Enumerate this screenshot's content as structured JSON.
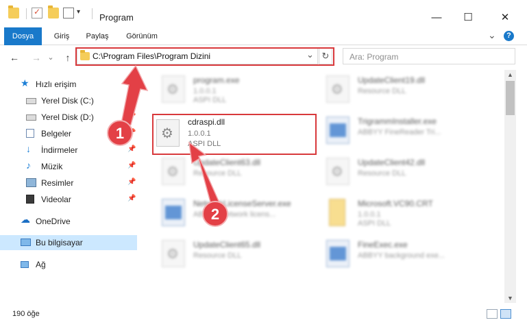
{
  "window": {
    "title": "Program",
    "min_glyph": "—",
    "max_glyph": "☐",
    "close_glyph": "✕"
  },
  "ribbon": {
    "tabs": [
      "Dosya",
      "Giriş",
      "Paylaş",
      "Görünüm"
    ],
    "expand_glyph": "⌄",
    "help_glyph": "?"
  },
  "nav": {
    "back_glyph": "←",
    "forward_glyph": "→",
    "recent_glyph": "⌄",
    "up_glyph": "↑",
    "address": "C:\\Program Files\\Program Dizini",
    "address_dropdown_glyph": "⌄",
    "refresh_glyph": "↻",
    "search_placeholder": "Ara: Program"
  },
  "sidebar": {
    "quick_access": "Hızlı erişim",
    "items": [
      {
        "label": "Yerel Disk (C:)",
        "icon": "drive-icon",
        "pinned": true
      },
      {
        "label": "Yerel Disk (D:)",
        "icon": "drive-icon",
        "pinned": true
      },
      {
        "label": "Belgeler",
        "icon": "documents-icon",
        "pinned": true
      },
      {
        "label": "İndirmeler",
        "icon": "downloads-icon",
        "pinned": true
      },
      {
        "label": "Müzik",
        "icon": "music-icon",
        "pinned": true
      },
      {
        "label": "Resimler",
        "icon": "pictures-icon",
        "pinned": true
      },
      {
        "label": "Videolar",
        "icon": "videos-icon",
        "pinned": true
      }
    ],
    "onedrive": "OneDrive",
    "this_pc": "Bu bilgisayar",
    "network": "Ağ",
    "pin_glyph": "📌"
  },
  "files": [
    {
      "name": "program.exe",
      "line2": "1.0.0.1",
      "line3": "ASPI DLL",
      "icon": "dll-file-icon"
    },
    {
      "name": "UpdateClient19.dll",
      "line2": "Resource DLL",
      "line3": "",
      "icon": "dll-file-icon"
    },
    {
      "name": "cdraspi.dll",
      "line2": "1.0.0.1",
      "line3": "ASPI DLL",
      "icon": "dll-file-icon"
    },
    {
      "name": "TrigrammInstaller.exe",
      "line2": "ABBYY FineReader Tri...",
      "line3": "",
      "icon": "application-icon"
    },
    {
      "name": "UpdateClient63.dll",
      "line2": "Resource DLL",
      "line3": "",
      "icon": "dll-file-icon"
    },
    {
      "name": "UpdateClient42.dll",
      "line2": "Resource DLL",
      "line3": "",
      "icon": "dll-file-icon"
    },
    {
      "name": "NetworkLicenseServer.exe",
      "line2": "ABBYY Network licens...",
      "line3": "",
      "icon": "application-icon"
    },
    {
      "name": "Microsoft.VC90.CRT",
      "line2": "1.0.0.1",
      "line3": "ASPI DLL",
      "icon": "folder-zip-icon"
    },
    {
      "name": "UpdateClient65.dll",
      "line2": "Resource DLL",
      "line3": "",
      "icon": "dll-file-icon"
    },
    {
      "name": "FineExec.exe",
      "line2": "ABBYY background exe...",
      "line3": "",
      "icon": "application-icon"
    }
  ],
  "status": {
    "count": "190 öğe"
  },
  "callouts": [
    "1",
    "2"
  ],
  "colors": {
    "accent": "#1979ca",
    "highlight_red": "#d8383b",
    "badge_red": "#e34046",
    "selected_nav": "#cce8ff"
  }
}
